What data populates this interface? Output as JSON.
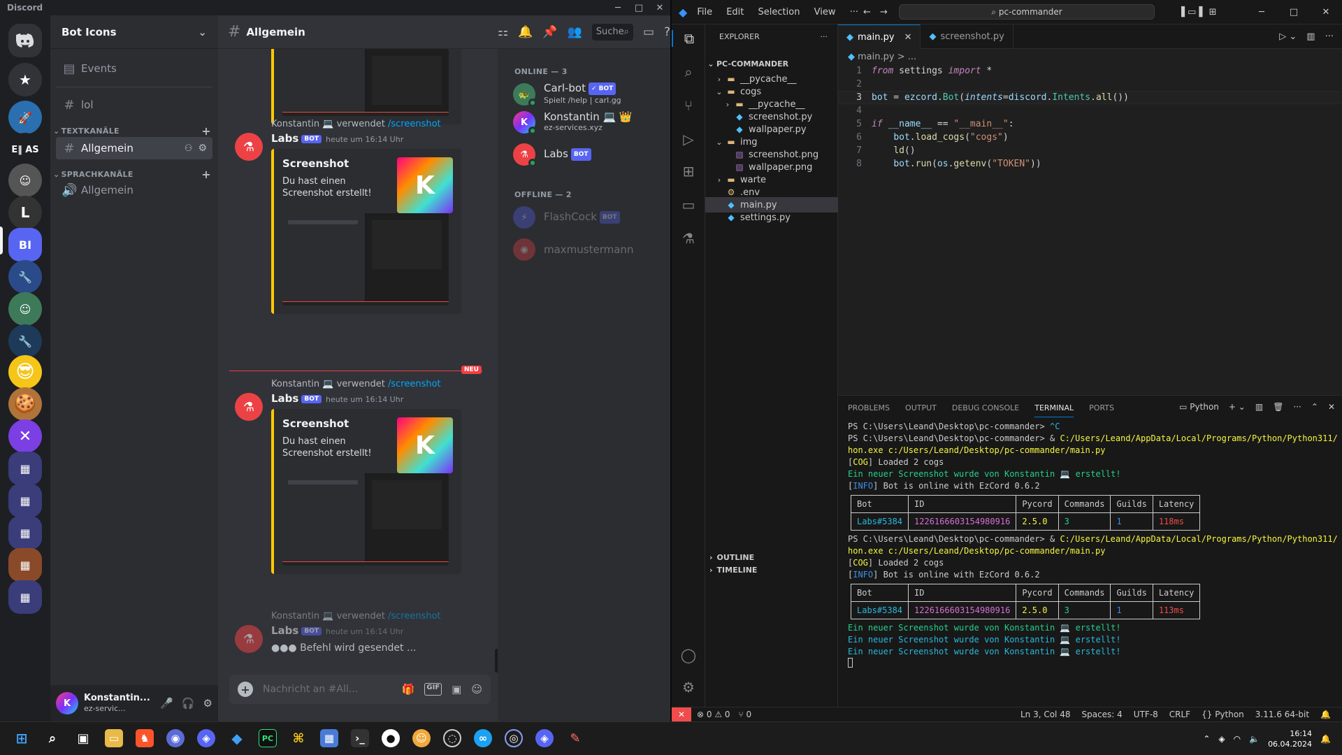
{
  "discord": {
    "app_title": "Discord",
    "window_controls": [
      "─",
      "□",
      "✕"
    ],
    "server_name": "Bot Icons",
    "guild_label_text": "E‖ AS",
    "guild_selected": "BI",
    "events_label": "Events",
    "channel_lol": "lol",
    "text_category": "TEXTKANÄLE",
    "voice_category": "SPRACHKANÄLE",
    "active_channel": "Allgemein",
    "voice_channel": "Allgemein",
    "channel_header": "Allgemein",
    "search_placeholder": "Suche",
    "user": {
      "name": "Konstantin...",
      "status": "ez-servic..."
    },
    "members": {
      "online_header": "ONLINE — 3",
      "offline_header": "OFFLINE — 2",
      "online": [
        {
          "name": "Carl-bot",
          "badge": "✓ BOT",
          "activity": "Spielt /help | carl.gg"
        },
        {
          "name": "Konstantin 💻 👑",
          "badge": "",
          "activity": "ez-services.xyz"
        },
        {
          "name": "Labs",
          "badge": "BOT",
          "activity": ""
        }
      ],
      "offline": [
        {
          "name": "FlashCock",
          "badge": "BOT"
        },
        {
          "name": "maxmustermann",
          "badge": ""
        }
      ]
    },
    "messages": [
      {
        "reply_user": "Konstantin 💻",
        "reply_verb": "verwendet",
        "reply_cmd": "/screenshot",
        "author": "Labs",
        "badge": "BOT",
        "time": "heute um 16:14 Uhr",
        "embed_title": "Screenshot",
        "embed_desc": "Du hast einen Screenshot erstellt!"
      },
      {
        "reply_user": "Konstantin 💻",
        "reply_verb": "verwendet",
        "reply_cmd": "/screenshot",
        "author": "Labs",
        "badge": "BOT",
        "time": "heute um 16:14 Uhr",
        "embed_title": "Screenshot",
        "embed_desc": "Du hast einen Screenshot erstellt!"
      },
      {
        "reply_user": "Konstantin 💻",
        "reply_verb": "verwendet",
        "reply_cmd": "/screenshot",
        "author": "Labs",
        "badge": "BOT",
        "time": "heute um 16:14 Uhr",
        "typing": "Befehl wird gesendet ..."
      }
    ],
    "new_tag": "NEU",
    "composer_placeholder": "Nachricht an #All...",
    "gif_label": "GIF"
  },
  "vscode": {
    "menu": [
      "File",
      "Edit",
      "Selection",
      "View",
      "···"
    ],
    "command_center": "pc-commander",
    "window_controls": [
      "─",
      "□",
      "✕"
    ],
    "explorer_title": "EXPLORER",
    "project": "PC-COMMANDER",
    "tree": [
      {
        "name": "__pycache__",
        "depth": 1,
        "type": "folder",
        "open": false
      },
      {
        "name": "cogs",
        "depth": 1,
        "type": "folder",
        "open": true
      },
      {
        "name": "__pycache__",
        "depth": 2,
        "type": "folder",
        "open": false
      },
      {
        "name": "screenshot.py",
        "depth": 2,
        "type": "py"
      },
      {
        "name": "wallpaper.py",
        "depth": 2,
        "type": "py"
      },
      {
        "name": "img",
        "depth": 1,
        "type": "folder",
        "open": true
      },
      {
        "name": "screenshot.png",
        "depth": 2,
        "type": "img"
      },
      {
        "name": "wallpaper.png",
        "depth": 2,
        "type": "img"
      },
      {
        "name": "warte",
        "depth": 1,
        "type": "folder",
        "open": false
      },
      {
        "name": ".env",
        "depth": 1,
        "type": "env"
      },
      {
        "name": "main.py",
        "depth": 1,
        "type": "py",
        "selected": true
      },
      {
        "name": "settings.py",
        "depth": 1,
        "type": "py"
      }
    ],
    "outline": "OUTLINE",
    "timeline": "TIMELINE",
    "tabs": [
      {
        "label": "main.py",
        "active": true
      },
      {
        "label": "screenshot.py",
        "active": false
      }
    ],
    "breadcrumb": "main.py > ...",
    "panel_tabs": [
      "PROBLEMS",
      "OUTPUT",
      "DEBUG CONSOLE",
      "TERMINAL",
      "PORTS"
    ],
    "terminal_kind": "Python",
    "table": {
      "headers": [
        "Bot",
        "ID",
        "Pycord",
        "Commands",
        "Guilds",
        "Latency"
      ],
      "run1": [
        "Labs#5384",
        "1226166603154980916",
        "2.5.0",
        "3",
        "1",
        "118ms"
      ],
      "run2": [
        "Labs#5384",
        "1226166603154980916",
        "2.5.0",
        "3",
        "1",
        "113ms"
      ]
    },
    "terminal_lines": {
      "prompt": "PS C:\\Users\\Leand\\Desktop\\pc-commander> ",
      "interrupt": "^C",
      "run_cmd_a": "& ",
      "run_cmd_b": "C:/Users/Leand/AppData/Local/Programs/Python/Python311/pyt",
      "run_cmd_c": "hon.exe c:/Users/Leand/Desktop/pc-commander/main.py",
      "cog_tag": "COG",
      "cog_msg": " Loaded 2 cogs",
      "info_tag": "INFO",
      "info_msg": " Bot is online with EzCord 0.6.2",
      "screenshot_msg": "Ein neuer Screenshot wurde von Konstantin 💻 erstellt!"
    },
    "status": {
      "errors": "⊗ 0 ⚠ 0",
      "ports": "⑂ 0",
      "position": "Ln 3, Col 48",
      "spaces": "Spaces: 4",
      "encoding": "UTF-8",
      "eol": "CRLF",
      "language": "Python",
      "interpreter": "3.11.6 64-bit"
    }
  },
  "taskbar": {
    "time": "16:14",
    "date": "06.04.2024"
  }
}
